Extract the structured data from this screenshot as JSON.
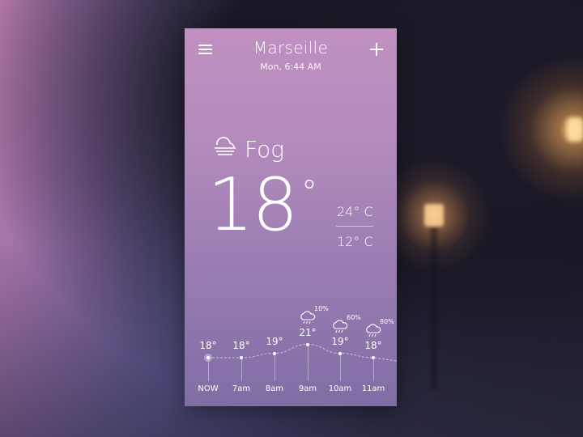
{
  "header": {
    "city": "Marseille",
    "datetime": "Mon, 6:44 AM"
  },
  "current": {
    "condition": "Fog",
    "condition_icon": "fog-icon",
    "temperature": "18",
    "degree_symbol": "°",
    "high": "24° C",
    "low": "12° C"
  },
  "hourly": [
    {
      "label": "NOW",
      "temp": "18°",
      "value": 18,
      "rain_pct": null
    },
    {
      "label": "7am",
      "temp": "18°",
      "value": 18,
      "rain_pct": null
    },
    {
      "label": "8am",
      "temp": "19°",
      "value": 19,
      "rain_pct": null
    },
    {
      "label": "9am",
      "temp": "21°",
      "value": 21,
      "rain_pct": "10%"
    },
    {
      "label": "10am",
      "temp": "19°",
      "value": 19,
      "rain_pct": "60%"
    },
    {
      "label": "11am",
      "temp": "18°",
      "value": 18,
      "rain_pct": "80%"
    }
  ],
  "icons": {
    "menu": "menu-icon",
    "add": "plus-icon",
    "rain": "rain-cloud-icon"
  },
  "colors": {
    "card_top": "#c090c0",
    "card_bottom": "#7e6ea4",
    "text": "#ffffff"
  }
}
